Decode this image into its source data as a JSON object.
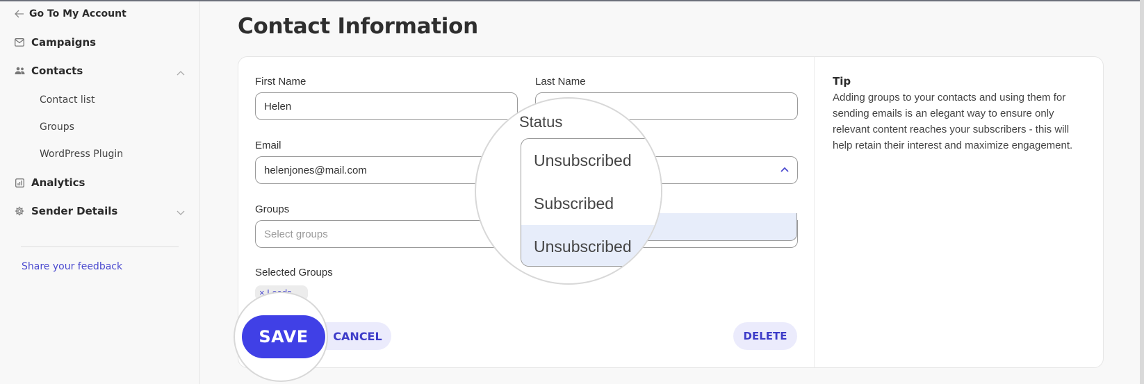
{
  "sidebar": {
    "back_label": "Go To My Account",
    "items": [
      {
        "label": "Campaigns",
        "icon": "mail-icon"
      },
      {
        "label": "Contacts",
        "icon": "users-icon",
        "expanded": true
      },
      {
        "label": "Analytics",
        "icon": "bar-chart-icon"
      },
      {
        "label": "Sender Details",
        "icon": "gear-icon",
        "expanded": false
      }
    ],
    "contacts_subitems": [
      "Contact list",
      "Groups",
      "WordPress Plugin"
    ],
    "feedback_link": "Share your feedback"
  },
  "main": {
    "title": "Contact Information",
    "form": {
      "first_name": {
        "label": "First Name",
        "value": "Helen"
      },
      "last_name": {
        "label": "Last Name",
        "value": ""
      },
      "email": {
        "label": "Email",
        "value": "helenjones@mail.com"
      },
      "status": {
        "label": "Status",
        "selected": "Unsubscribed",
        "options": [
          "Subscribed",
          "Unsubscribed"
        ]
      },
      "groups": {
        "label": "Groups",
        "placeholder": "Select groups"
      },
      "selected_groups": {
        "label": "Selected Groups",
        "chips": [
          "Leads"
        ]
      },
      "chip_remove_glyph": "×"
    },
    "buttons": {
      "save": "SAVE",
      "cancel": "CANCEL",
      "delete": "DELETE"
    },
    "tip": {
      "title": "Tip",
      "body": "Adding groups to your contacts and using them for sending emails is an elegant way to ensure only relevant content reaches your subscribers - this will help retain their interest and maximize engagement."
    }
  },
  "colors": {
    "accent": "#4040e6",
    "accent_light": "#ebebfc",
    "link": "#4b4acf",
    "highlight": "#e7edfa"
  }
}
